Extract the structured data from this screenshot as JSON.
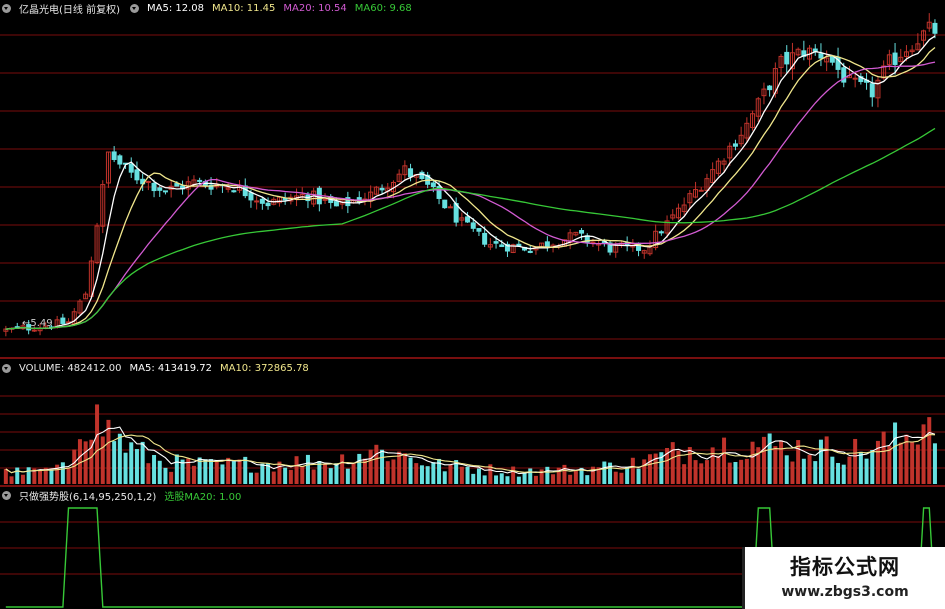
{
  "price_header": {
    "title": "亿晶光电(日线 前复权)",
    "ma5_text": "MA5: 12.08",
    "ma10_text": "MA10: 11.45",
    "ma20_text": "MA20: 10.54",
    "ma60_text": "MA60: 9.68",
    "low_label": "←5.49"
  },
  "volume_header": {
    "volume_text": "VOLUME: 482412.00",
    "ma5_text": "MA5: 413419.72",
    "ma10_text": "MA10: 372865.78"
  },
  "indicator_header": {
    "name": "只做强势股(6,14,95,250,1,2)",
    "signal_text": "选股MA20: 1.00"
  },
  "watermark": {
    "title": "指标公式网",
    "url": "www.zbgs3.com"
  },
  "colors": {
    "background": "#000000",
    "up": "#c0332b",
    "down": "#66e0e0",
    "ma5": "#ffffff",
    "ma10": "#f0e68c",
    "ma20": "#d25bd2",
    "ma60": "#37c837",
    "grid": "#7a0c0c",
    "separator": "#a01414",
    "signal": "#37c837"
  },
  "chart_data": [
    {
      "type": "candlestick",
      "title": "亿晶光电(日线 前复权)",
      "ylim": [
        5.0,
        13.2
      ],
      "annotations": [
        "←5.49"
      ],
      "anchors": [
        [
          0,
          5.6
        ],
        [
          6,
          5.7
        ],
        [
          11,
          5.8
        ],
        [
          14,
          6.5
        ],
        [
          18,
          9.9
        ],
        [
          22,
          9.4
        ],
        [
          28,
          9.0
        ],
        [
          33,
          9.2
        ],
        [
          40,
          9.1
        ],
        [
          46,
          8.7
        ],
        [
          53,
          8.9
        ],
        [
          58,
          8.6
        ],
        [
          64,
          8.9
        ],
        [
          70,
          9.5
        ],
        [
          74,
          9.1
        ],
        [
          80,
          8.2
        ],
        [
          85,
          7.7
        ],
        [
          92,
          7.6
        ],
        [
          100,
          7.9
        ],
        [
          106,
          7.6
        ],
        [
          112,
          7.6
        ],
        [
          118,
          8.5
        ],
        [
          124,
          9.5
        ],
        [
          130,
          10.6
        ],
        [
          136,
          12.1
        ],
        [
          140,
          12.4
        ],
        [
          144,
          12.3
        ],
        [
          148,
          11.6
        ],
        [
          152,
          11.4
        ],
        [
          155,
          12.1
        ],
        [
          159,
          12.6
        ],
        [
          162,
          12.9
        ]
      ],
      "series": [
        {
          "name": "MA5",
          "value": 12.08
        },
        {
          "name": "MA10",
          "value": 11.45
        },
        {
          "name": "MA20",
          "value": 10.54
        },
        {
          "name": "MA60",
          "value": 9.68
        }
      ]
    },
    {
      "type": "bar",
      "title": "VOLUME",
      "ylim": [
        0,
        740000
      ],
      "anchors": [
        [
          0,
          80000
        ],
        [
          9,
          95000
        ],
        [
          11,
          130000
        ],
        [
          13,
          500000
        ],
        [
          16,
          440000
        ],
        [
          22,
          240000
        ],
        [
          28,
          150000
        ],
        [
          36,
          130000
        ],
        [
          48,
          150000
        ],
        [
          58,
          160000
        ],
        [
          64,
          240000
        ],
        [
          68,
          220000
        ],
        [
          76,
          130000
        ],
        [
          88,
          90000
        ],
        [
          100,
          100000
        ],
        [
          110,
          140000
        ],
        [
          120,
          250000
        ],
        [
          130,
          280000
        ],
        [
          140,
          250000
        ],
        [
          150,
          230000
        ],
        [
          158,
          330000
        ],
        [
          162,
          480000
        ]
      ],
      "series": [
        {
          "name": "VOLUME",
          "value": 482412.0
        },
        {
          "name": "MA5",
          "value": 413419.72
        },
        {
          "name": "MA10",
          "value": 372865.78
        }
      ]
    },
    {
      "type": "line",
      "title": "只做强势股(6,14,95,250,1,2)",
      "ylim": [
        0,
        1
      ],
      "high_ranges": [
        [
          11,
          16
        ],
        [
          132,
          134
        ],
        [
          161,
          162
        ]
      ],
      "series": [
        {
          "name": "选股MA20",
          "value": 1.0
        }
      ]
    }
  ]
}
